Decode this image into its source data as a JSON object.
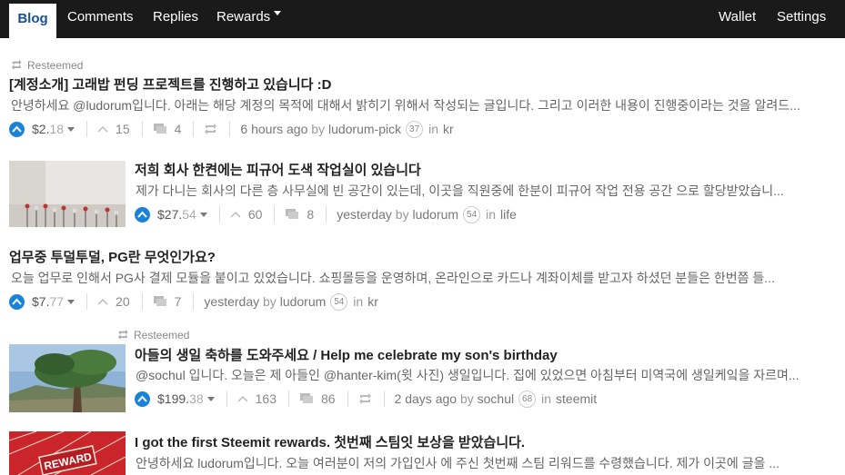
{
  "nav": {
    "tabs": [
      "Blog",
      "Comments",
      "Replies",
      "Rewards"
    ],
    "right": [
      "Wallet",
      "Settings"
    ]
  },
  "resteemed_label": "Resteemed",
  "by_label": "by",
  "in_label": "in",
  "posts": [
    {
      "title": "[계정소개] 고래밥 펀딩 프로젝트를 진행하고 있습니다 :D",
      "excerpt": "안녕하세요 @ludorum입니다. 아래는 해당 계정의 목적에 대해서 밝히기 위해서 작성되는 글입니다. 그리고 이러한 내용이 진행중이라는 것을 알려드...",
      "payout_int": "$2.",
      "payout_dec": "18",
      "votes": "15",
      "comments": "4",
      "time": "6 hours ago",
      "author": "ludorum-pick",
      "rep": "37",
      "category": "kr"
    },
    {
      "title": "저희 회사 한켠에는 피규어 도색 작업실이 있습니다",
      "excerpt": "제가 다니는 회사의 다른 층 사무실에 빈 공간이 있는데, 이곳을 직원중에 한분이 피규어 작업 전용 공간 으로 할당받았습니...",
      "payout_int": "$27.",
      "payout_dec": "54",
      "votes": "60",
      "comments": "8",
      "time": "yesterday",
      "author": "ludorum",
      "rep": "54",
      "category": "life"
    },
    {
      "title": "업무중 투덜투덜, PG란 무엇인가요?",
      "excerpt": "오늘 업무로 인해서 PG사 결제 모듈을 붙이고 있었습니다. 쇼핑몰등을 운영하며, 온라인으로 카드나 계좌이체를 받고자 하셨던 분들은 한번쯤 들...",
      "payout_int": "$7.",
      "payout_dec": "77",
      "votes": "20",
      "comments": "7",
      "time": "yesterday",
      "author": "ludorum",
      "rep": "54",
      "category": "kr"
    },
    {
      "title": "아들의 생일 축하를 도와주세요 / Help me celebrate my son's birthday",
      "excerpt": "@sochul 입니다. 오늘은 제 아들인 @hanter-kim(윗 사진) 생일입니다. 집에 있었으면 아침부터 미역국에 생일케잌을 자르며...",
      "payout_int": "$199.",
      "payout_dec": "38",
      "votes": "163",
      "comments": "86",
      "time": "2 days ago",
      "author": "sochul",
      "rep": "68",
      "category": "steemit"
    },
    {
      "title": "I got the first Steemit rewards. 첫번째 스팀잇 보상을 받았습니다.",
      "excerpt": "안녕하세요 ludorum입니다. 오늘 여러분이 저의 가입인사 에 주신 첫번째 스팀 리워드를 수령했습니다. 제가 이곳에 글을 ...",
      "thumb_text": "REWARD"
    }
  ]
}
